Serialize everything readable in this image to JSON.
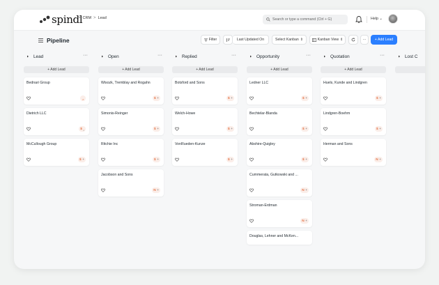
{
  "app": {
    "logo_text": "spindl",
    "breadcrumbs": [
      "CRM",
      "Lead"
    ],
    "breadcrumb_sep": ">"
  },
  "navbar": {
    "search_placeholder": "Search or type a command (Ctrl + G)",
    "help_label": "Help",
    "help_chevron": "⌄"
  },
  "page": {
    "title": "Pipeline"
  },
  "toolbar": {
    "filter_label": "Filter",
    "sort_label": "Last Updated On",
    "select_kanban_label": "Select Kanban",
    "kanban_view_label": "Kanban View",
    "more_label": "···",
    "add_lead_label": "+ Add Lead"
  },
  "colors": {
    "primary": "#2b7fff",
    "badge_bg": "#fbeee9",
    "badge_icon": "#e5774b"
  },
  "columns": [
    {
      "name": "Lead",
      "add_label": "+ Add Lead",
      "more": "···",
      "cards": [
        {
          "title": "Bednari Group",
          "badge": "‸"
        },
        {
          "title": "Dietrich LLC",
          "badge": "$ ‸"
        },
        {
          "title": "McCullough Group",
          "badge": "$ +"
        }
      ]
    },
    {
      "name": "Open",
      "add_label": "+ Add Lead",
      "more": "···",
      "cards": [
        {
          "title": "Wisozk, Tremblay and Rogahn",
          "badge": "$ +"
        },
        {
          "title": "Simonis-Reinger",
          "badge": "$ +"
        },
        {
          "title": "Ritchie Inc",
          "badge": "$ +"
        },
        {
          "title": "Jacobson and Sons",
          "badge": "N +"
        }
      ]
    },
    {
      "name": "Replied",
      "add_label": "+ Add Lead",
      "more": "···",
      "cards": [
        {
          "title": "Botsford and Sons",
          "badge": "$ +"
        },
        {
          "title": "Welch-Howe",
          "badge": "$ +"
        },
        {
          "title": "VonRueden-Kunze",
          "badge": "$ +"
        }
      ]
    },
    {
      "name": "Opportunity",
      "add_label": "+ Add Lead",
      "more": "···",
      "cards": [
        {
          "title": "Ledner LLC",
          "badge": "$ +"
        },
        {
          "title": "Bechtelar-Blanda",
          "badge": "$ +"
        },
        {
          "title": "Abshire-Quigley",
          "badge": "$ +"
        },
        {
          "title": "Cummerata, Gutkowski and ...",
          "badge": "N +"
        },
        {
          "title": "Stroman-Erdman",
          "badge": "N +"
        },
        {
          "title": "Douglas, Lehner and McKen...",
          "badge": ""
        }
      ]
    },
    {
      "name": "Quotation",
      "add_label": "+ Add Lead",
      "more": "···",
      "cards": [
        {
          "title": "Huels, Kunde and Lindgren",
          "badge": "$ +"
        },
        {
          "title": "Lindgren-Boehm",
          "badge": "$ +"
        },
        {
          "title": "Herman and Sons",
          "badge": "N +"
        }
      ]
    },
    {
      "name": "Lost C",
      "add_label": "",
      "more": "",
      "cards": []
    }
  ]
}
